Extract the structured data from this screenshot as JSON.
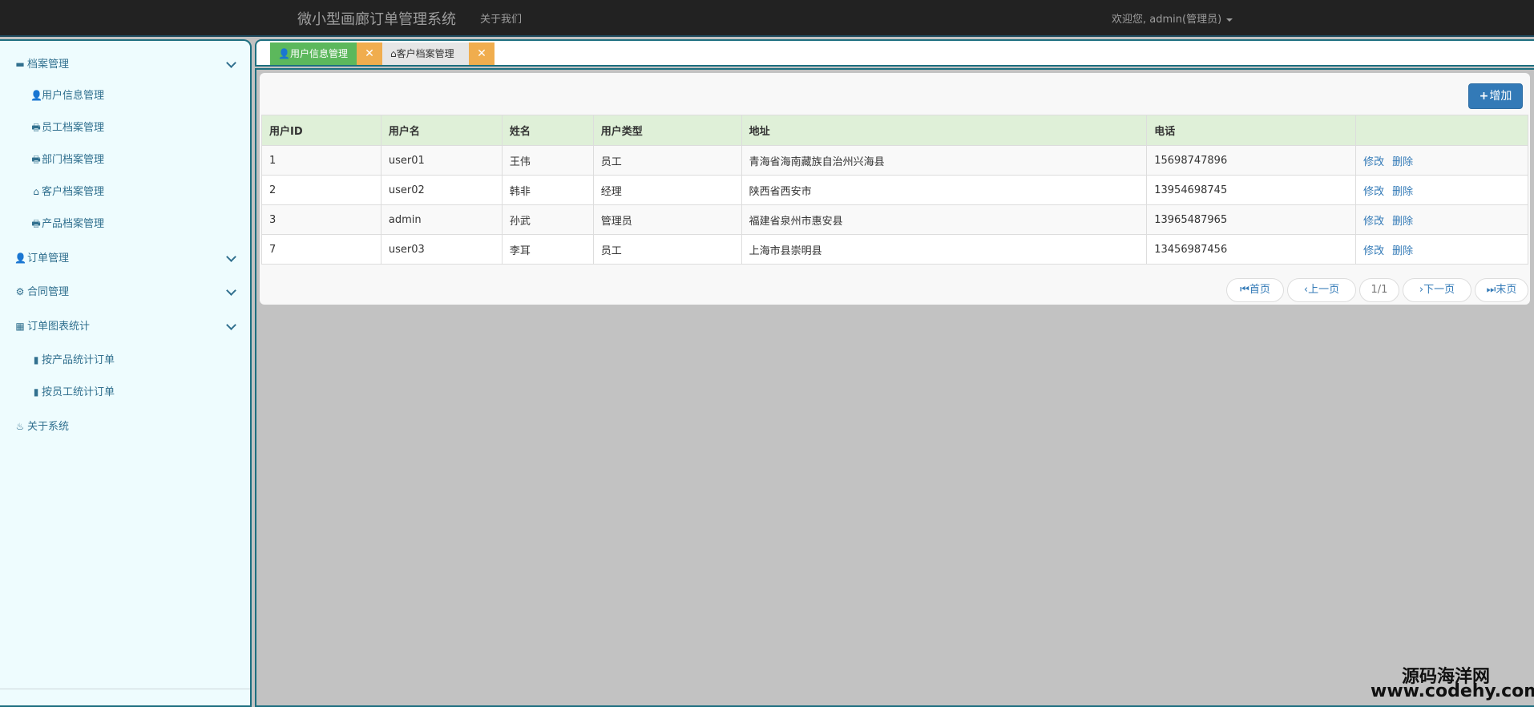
{
  "navbar": {
    "brand": "微小型画廊订单管理系统",
    "about": "关于我们",
    "user": "欢迎您, admin(管理员)"
  },
  "sidebar": {
    "groups": [
      {
        "label": "档案管理",
        "icon": "card-icon"
      },
      {
        "label": "订单管理",
        "icon": "user-icon"
      },
      {
        "label": "合同管理",
        "icon": "gear-icon"
      },
      {
        "label": "订单图表统计",
        "icon": "calendar-icon"
      },
      {
        "label": "关于系统",
        "icon": "fire-icon"
      }
    ],
    "archive_items": [
      {
        "label": "用户信息管理",
        "icon": "user-icon"
      },
      {
        "label": "员工档案管理",
        "icon": "print-icon"
      },
      {
        "label": "部门档案管理",
        "icon": "print-icon"
      },
      {
        "label": "客户档案管理",
        "icon": "home-icon"
      },
      {
        "label": "产品档案管理",
        "icon": "print-icon"
      }
    ],
    "stats_items": [
      {
        "label": "按产品统计订单",
        "icon": "bar-chart-icon"
      },
      {
        "label": "按员工统计订单",
        "icon": "bar-chart-icon"
      }
    ]
  },
  "tabs": [
    {
      "label": "用户信息管理",
      "active": true
    },
    {
      "label": "客户档案管理",
      "active": false
    }
  ],
  "toolbar": {
    "add_label": "增加"
  },
  "table": {
    "columns": [
      "用户ID",
      "用户名",
      "姓名",
      "用户类型",
      "地址",
      "电话",
      ""
    ],
    "rows": [
      {
        "id": "1",
        "username": "user01",
        "name": "王伟",
        "type": "员工",
        "address": "青海省海南藏族自治州兴海县",
        "phone": "15698747896"
      },
      {
        "id": "2",
        "username": "user02",
        "name": "韩非",
        "type": "经理",
        "address": "陕西省西安市",
        "phone": "13954698745"
      },
      {
        "id": "3",
        "username": "admin",
        "name": "孙武",
        "type": "管理员",
        "address": "福建省泉州市惠安县",
        "phone": "13965487965"
      },
      {
        "id": "7",
        "username": "user03",
        "name": "李耳",
        "type": "员工",
        "address": "上海市县崇明县",
        "phone": "13456987456"
      }
    ],
    "edit_label": "修改",
    "delete_label": "删除"
  },
  "pager": {
    "first": "首页",
    "prev": "上一页",
    "current": "1/1",
    "next": "下一页",
    "last": "末页"
  },
  "watermark": {
    "line1": "源码海洋网",
    "line2": "www.codehy.com"
  },
  "colors": {
    "accent": "#337ab7",
    "tab_active": "#5cb85c",
    "tab_close": "#f0ad4e",
    "header_row": "#dff0d8",
    "sidebar_bg": "#eefcfe"
  }
}
